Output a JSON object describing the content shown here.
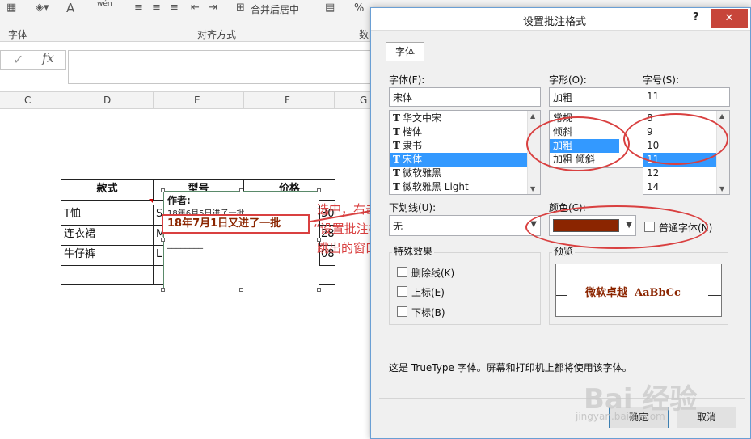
{
  "ribbon": {
    "font_group": "字体",
    "align_group": "对齐方式",
    "number_group": "数",
    "merge_label": "合并后居中",
    "wen_label": "wén",
    "font_color_glyph": "A",
    "percent_glyph": "%",
    "comma_glyph": ","
  },
  "formula_bar": {
    "fx": "fx",
    "check": "✓"
  },
  "columns": [
    "C",
    "D",
    "E",
    "F",
    "G"
  ],
  "table": {
    "headers": [
      "款式",
      "型号",
      "价格"
    ],
    "rows": [
      {
        "name": "T恤",
        "code": "S",
        "price": "30"
      },
      {
        "name": "连衣裙",
        "code": "M",
        "price": "28"
      },
      {
        "name": "牛仔裤",
        "code": "L",
        "price": "08"
      }
    ]
  },
  "comment": {
    "author": "作者:",
    "line1": "18年6月5日进了一批",
    "line2": "18年7月1日又进了一批",
    "line3": "________"
  },
  "annotation": {
    "line1": "选中，右击",
    "line2": "“设置批注格式”",
    "line3": "跳出的窗口"
  },
  "dialog": {
    "title": "设置批注格式",
    "help": "?",
    "close": "✕",
    "tab": "字体",
    "font_label": "字体(F):",
    "font_value": "宋体",
    "fonts": [
      "华文中宋",
      "楷体",
      "隶书",
      "宋体",
      "微软雅黑",
      "微软雅黑 Light"
    ],
    "font_selected_index": 3,
    "style_label": "字形(O):",
    "style_value": "加粗",
    "styles": [
      "常规",
      "倾斜",
      "加粗",
      "加粗 倾斜"
    ],
    "style_selected_index": 2,
    "size_label": "字号(S):",
    "size_value": "11",
    "sizes": [
      "8",
      "9",
      "10",
      "11",
      "12",
      "14"
    ],
    "size_selected_index": 3,
    "underline_label": "下划线(U):",
    "underline_value": "无",
    "color_label": "颜色(C):",
    "color_value": "#8b2500",
    "normal_font_label": "普通字体(N)",
    "effects_label": "特殊效果",
    "strikethrough": "删除线(K)",
    "superscript": "上标(E)",
    "subscript": "下标(B)",
    "preview_label": "预览",
    "preview_text": "微软卓越  AaBbCc",
    "info": "这是 TrueType 字体。屏幕和打印机上都将使用该字体。",
    "ok": "确定",
    "cancel": "取消"
  },
  "watermark": {
    "main": "Bai 经验",
    "url": "jingyan.baidu.com"
  },
  "colors": {
    "accent": "#d94040",
    "selection": "#3399ff",
    "preview": "#8b2500"
  }
}
